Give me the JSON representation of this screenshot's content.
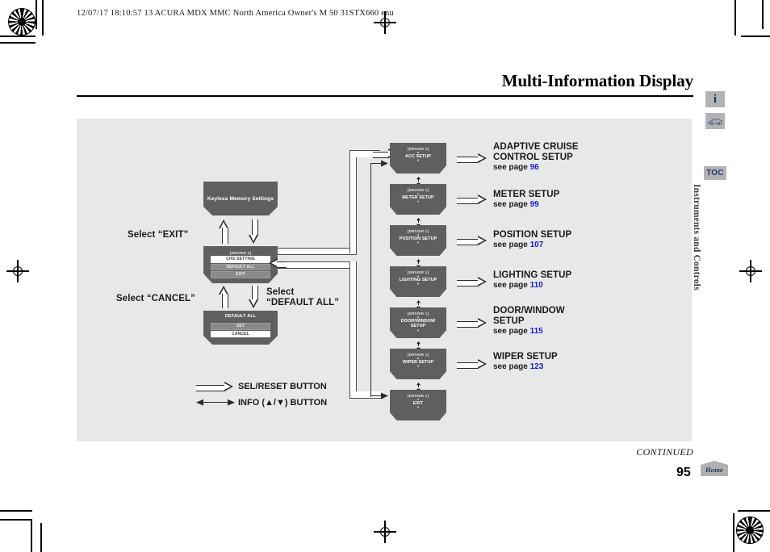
{
  "header": {
    "print_info": "12/07/17 18:10:57    13 ACURA MDX MMC North America Owner's M 50 31STX660 enu"
  },
  "title": "Multi-Information Display",
  "sidebar": {
    "info_icon_glyph": "i",
    "car_icon_name": "vehicle-icon",
    "toc_label": "TOC",
    "section_label": "Instruments and Controls"
  },
  "diagram": {
    "keyless_screen": {
      "title": "Keyless Memory Settings"
    },
    "driver_menu_screen": {
      "header": "[DRIVER 1]",
      "rows": [
        {
          "label": "CHG SETTING",
          "selected": true
        },
        {
          "label": "DEFAULT ALL",
          "selected": false
        },
        {
          "label": "EXIT",
          "selected": false
        }
      ]
    },
    "default_all_screen": {
      "title": "DEFAULT ALL",
      "rows": [
        {
          "label": "SET",
          "selected": false
        },
        {
          "label": "CANCEL",
          "selected": true
        }
      ]
    },
    "left_labels": {
      "select_exit": "Select “EXIT”",
      "select_cancel": "Select “CANCEL”",
      "select_default_all_line1": "Select",
      "select_default_all_line2": "“DEFAULT ALL”"
    },
    "screens": [
      {
        "header": "[DRIVER 1]",
        "label": "ACC SETUP"
      },
      {
        "header": "[DRIVER 1]",
        "label": "METER SETUP"
      },
      {
        "header": "[DRIVER 1]",
        "label": "POSITION SETUP"
      },
      {
        "header": "[DRIVER 1]",
        "label": "LIGHTING SETUP"
      },
      {
        "header": "[DRIVER 1]",
        "label": "DOOR/WINDOW\nSETUP"
      },
      {
        "header": "[DRIVER 1]",
        "label": "WIPER SETUP"
      },
      {
        "header": "[DRIVER 1]",
        "label": "EXIT"
      }
    ],
    "references": [
      {
        "title_line1": "ADAPTIVE CRUISE",
        "title_line2": "CONTROL SETUP",
        "see_page": "see page",
        "page": "96"
      },
      {
        "title_line1": "METER SETUP",
        "title_line2": "",
        "see_page": "see page",
        "page": "99"
      },
      {
        "title_line1": "POSITION SETUP",
        "title_line2": "",
        "see_page": "see page",
        "page": "107"
      },
      {
        "title_line1": "LIGHTING SETUP",
        "title_line2": "",
        "see_page": "see page",
        "page": "110"
      },
      {
        "title_line1": "DOOR/WINDOW",
        "title_line2": "SETUP",
        "see_page": "see page",
        "page": "115"
      },
      {
        "title_line1": "WIPER SETUP",
        "title_line2": "",
        "see_page": "see page",
        "page": "123"
      }
    ],
    "legend": [
      {
        "icon": "hollow-arrow-icon",
        "label": "SEL/RESET BUTTON"
      },
      {
        "icon": "double-arrow-icon",
        "label": "INFO (▲/▼) BUTTON"
      }
    ]
  },
  "footer": {
    "continued": "CONTINUED",
    "page_number": "95",
    "home_label": "Home"
  },
  "colors": {
    "panel_bg": "#e8e8e8",
    "screen_bg": "#5f5f5f",
    "link_blue": "#1a1ae0",
    "toc_navy": "#1c3b70",
    "icon_gray": "#b3b3b3"
  }
}
